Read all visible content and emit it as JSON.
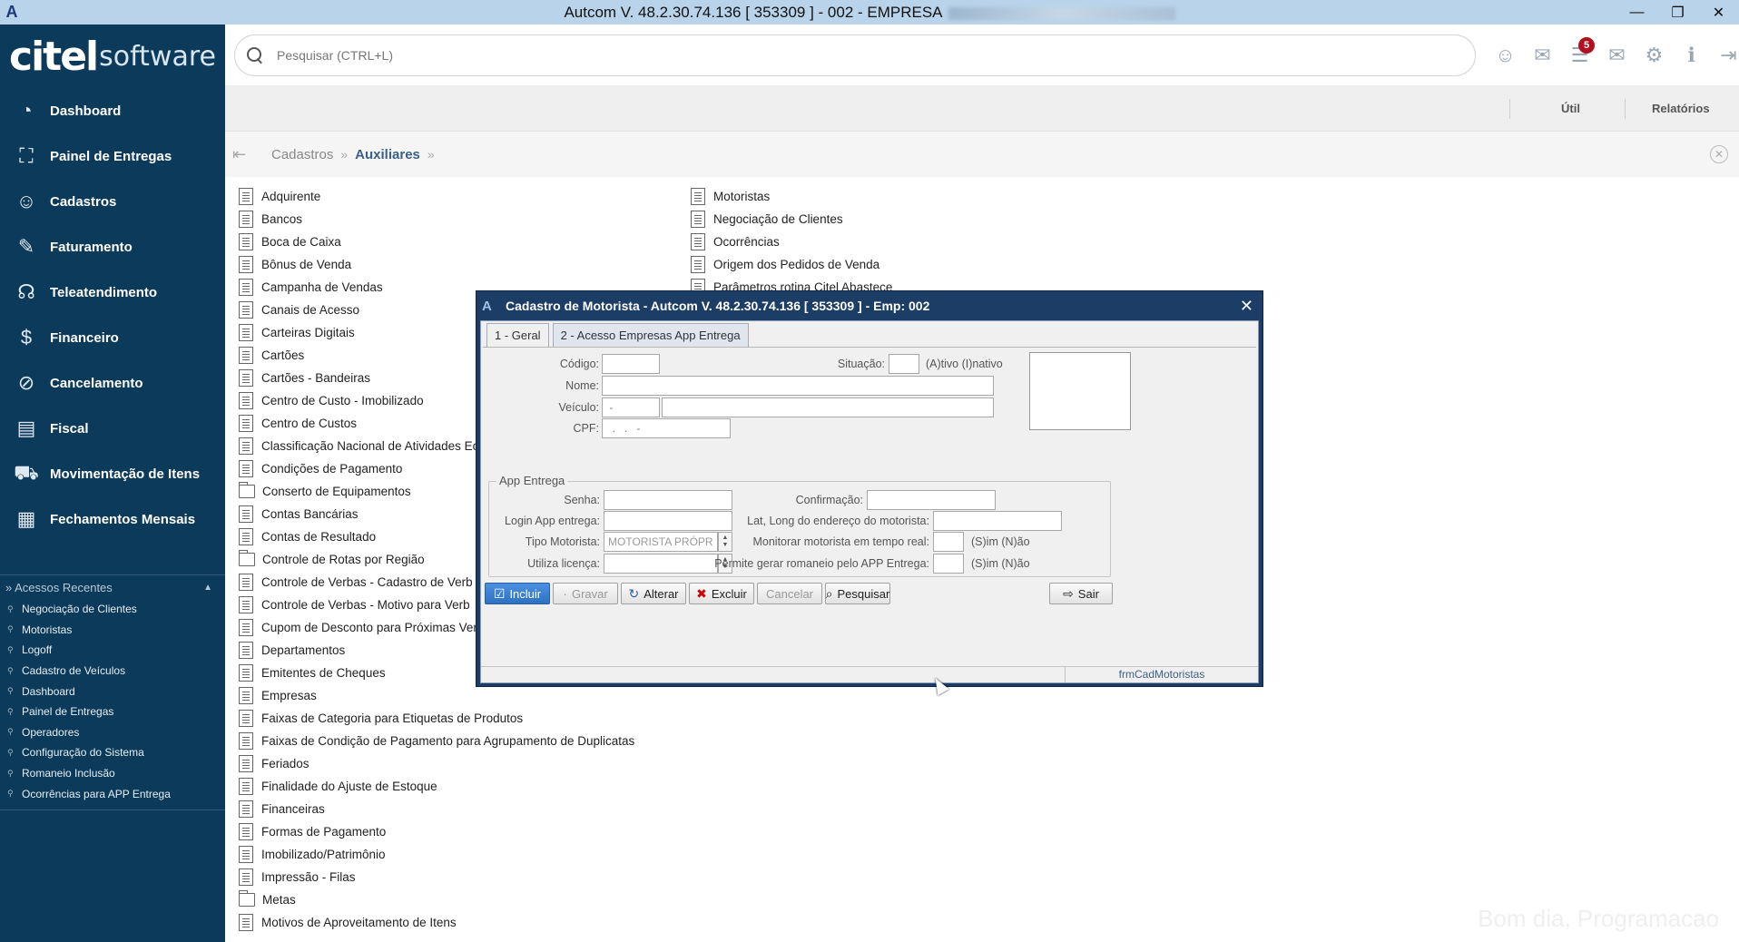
{
  "window": {
    "title": "Autcom V. 48.2.30.74.136 [ 353309 ] - 002 - EMPRESA",
    "controls": {
      "minimize": "—",
      "restore": "❐",
      "close": "✕"
    }
  },
  "logo": {
    "part1": "citel",
    "part2": "software"
  },
  "sidebar": {
    "items": [
      {
        "label": "Dashboard",
        "icon": "dashboard-icon"
      },
      {
        "label": "Painel de Entregas",
        "icon": "map-icon"
      },
      {
        "label": "Cadastros",
        "icon": "user-add-icon"
      },
      {
        "label": "Faturamento",
        "icon": "tag-icon"
      },
      {
        "label": "Teleatendimento",
        "icon": "headset-icon"
      },
      {
        "label": "Financeiro",
        "icon": "money-icon"
      },
      {
        "label": "Cancelamento",
        "icon": "cancel-icon"
      },
      {
        "label": "Fiscal",
        "icon": "book-icon"
      },
      {
        "label": "Movimentação de Itens",
        "icon": "truck-icon"
      },
      {
        "label": "Fechamentos Mensais",
        "icon": "calendar-icon"
      }
    ],
    "recent_title": "» Acessos Recentes",
    "recent": [
      "Negociação de Clientes",
      "Motoristas",
      "Logoff",
      "Cadastro de Veículos",
      "Dashboard",
      "Painel de Entregas",
      "Operadores",
      "Configuração do Sistema",
      "Romaneio Inclusão",
      "Ocorrências para APP Entrega"
    ]
  },
  "search": {
    "placeholder": "Pesquisar (CTRL+L)"
  },
  "top_icons": {
    "notification_count": "5"
  },
  "subbar": {
    "util": "Útil",
    "reports": "Relatórios"
  },
  "breadcrumb": {
    "first": "Cadastros",
    "second": "Auxiliares"
  },
  "list_left": [
    {
      "label": "Adquirente",
      "type": "file"
    },
    {
      "label": "Bancos",
      "type": "file"
    },
    {
      "label": "Boca de Caixa",
      "type": "file"
    },
    {
      "label": "Bônus de Venda",
      "type": "file"
    },
    {
      "label": "Campanha de Vendas",
      "type": "file"
    },
    {
      "label": "Canais de Acesso",
      "type": "file"
    },
    {
      "label": "Carteiras Digitais",
      "type": "file"
    },
    {
      "label": "Cartões",
      "type": "file"
    },
    {
      "label": "Cartões - Bandeiras",
      "type": "file"
    },
    {
      "label": "Centro de Custo - Imobilizado",
      "type": "file"
    },
    {
      "label": "Centro de Custos",
      "type": "file"
    },
    {
      "label": "Classificação Nacional de Atividades Ec",
      "type": "file"
    },
    {
      "label": "Condições de Pagamento",
      "type": "file"
    },
    {
      "label": "Conserto de Equipamentos",
      "type": "folder"
    },
    {
      "label": "Contas Bancárias",
      "type": "file"
    },
    {
      "label": "Contas de Resultado",
      "type": "file"
    },
    {
      "label": "Controle de Rotas por Região",
      "type": "folder"
    },
    {
      "label": "Controle de Verbas - Cadastro de Verb",
      "type": "file"
    },
    {
      "label": "Controle de Verbas - Motivo para Verb",
      "type": "file"
    },
    {
      "label": "Cupom de Desconto para Próximas Ver",
      "type": "file"
    },
    {
      "label": "Departamentos",
      "type": "file"
    },
    {
      "label": "Emitentes de Cheques",
      "type": "file"
    },
    {
      "label": "Empresas",
      "type": "file"
    },
    {
      "label": "Faixas de Categoria para Etiquetas de Produtos",
      "type": "file"
    },
    {
      "label": "Faixas de Condição de Pagamento para Agrupamento de Duplicatas",
      "type": "file"
    },
    {
      "label": "Feriados",
      "type": "file"
    },
    {
      "label": "Finalidade do Ajuste de Estoque",
      "type": "file"
    },
    {
      "label": "Financeiras",
      "type": "file"
    },
    {
      "label": "Formas de Pagamento",
      "type": "file"
    },
    {
      "label": "Imobilizado/Patrimônio",
      "type": "file"
    },
    {
      "label": "Impressão - Filas",
      "type": "file"
    },
    {
      "label": "Metas",
      "type": "folder"
    },
    {
      "label": "Motivos de Aproveitamento de Itens",
      "type": "file"
    }
  ],
  "list_right": [
    {
      "label": "Motoristas",
      "type": "file"
    },
    {
      "label": "Negociação de Clientes",
      "type": "file"
    },
    {
      "label": "Ocorrências",
      "type": "file"
    },
    {
      "label": "Origem dos Pedidos de Venda",
      "type": "file"
    },
    {
      "label": "Parâmetros rotina Citel Abastece",
      "type": "file"
    }
  ],
  "greeting": "Bom dia, Programacao",
  "dialog": {
    "title": "Cadastro de Motorista   -   Autcom V. 48.2.30.74.136 [ 353309 ] - Emp: 002",
    "tabs": [
      "1 - Geral",
      "2 - Acesso Empresas App Entrega"
    ],
    "labels": {
      "codigo": "Código:",
      "situacao": "Situação:",
      "situacao_hint": "(A)tivo (I)nativo",
      "nome": "Nome:",
      "veiculo": "Veículo:",
      "cpf": "CPF:",
      "app_group": "App Entrega",
      "senha": "Senha:",
      "confirmacao": "Confirmação:",
      "login": "Login App entrega:",
      "latlong": "Lat, Long do endereço do motorista:",
      "tipo": "Tipo Motorista:",
      "monitorar": "Monitorar motorista em tempo real:",
      "licenca": "Utiliza licença:",
      "romaneio": "Permite gerar romaneio pelo APP Entrega:",
      "sn_hint": "(S)im (N)ão"
    },
    "values": {
      "veiculo_code": " -",
      "cpf": "  .   .   -",
      "tipo": "MOTORISTA PRÓPRIO"
    },
    "buttons": {
      "incluir": "Incluir",
      "gravar": "Gravar",
      "alterar": "Alterar",
      "excluir": "Excluir",
      "cancelar": "Cancelar",
      "pesquisar": "Pesquisar",
      "sair": "Sair"
    },
    "status_form": "frmCadMotoristas"
  }
}
